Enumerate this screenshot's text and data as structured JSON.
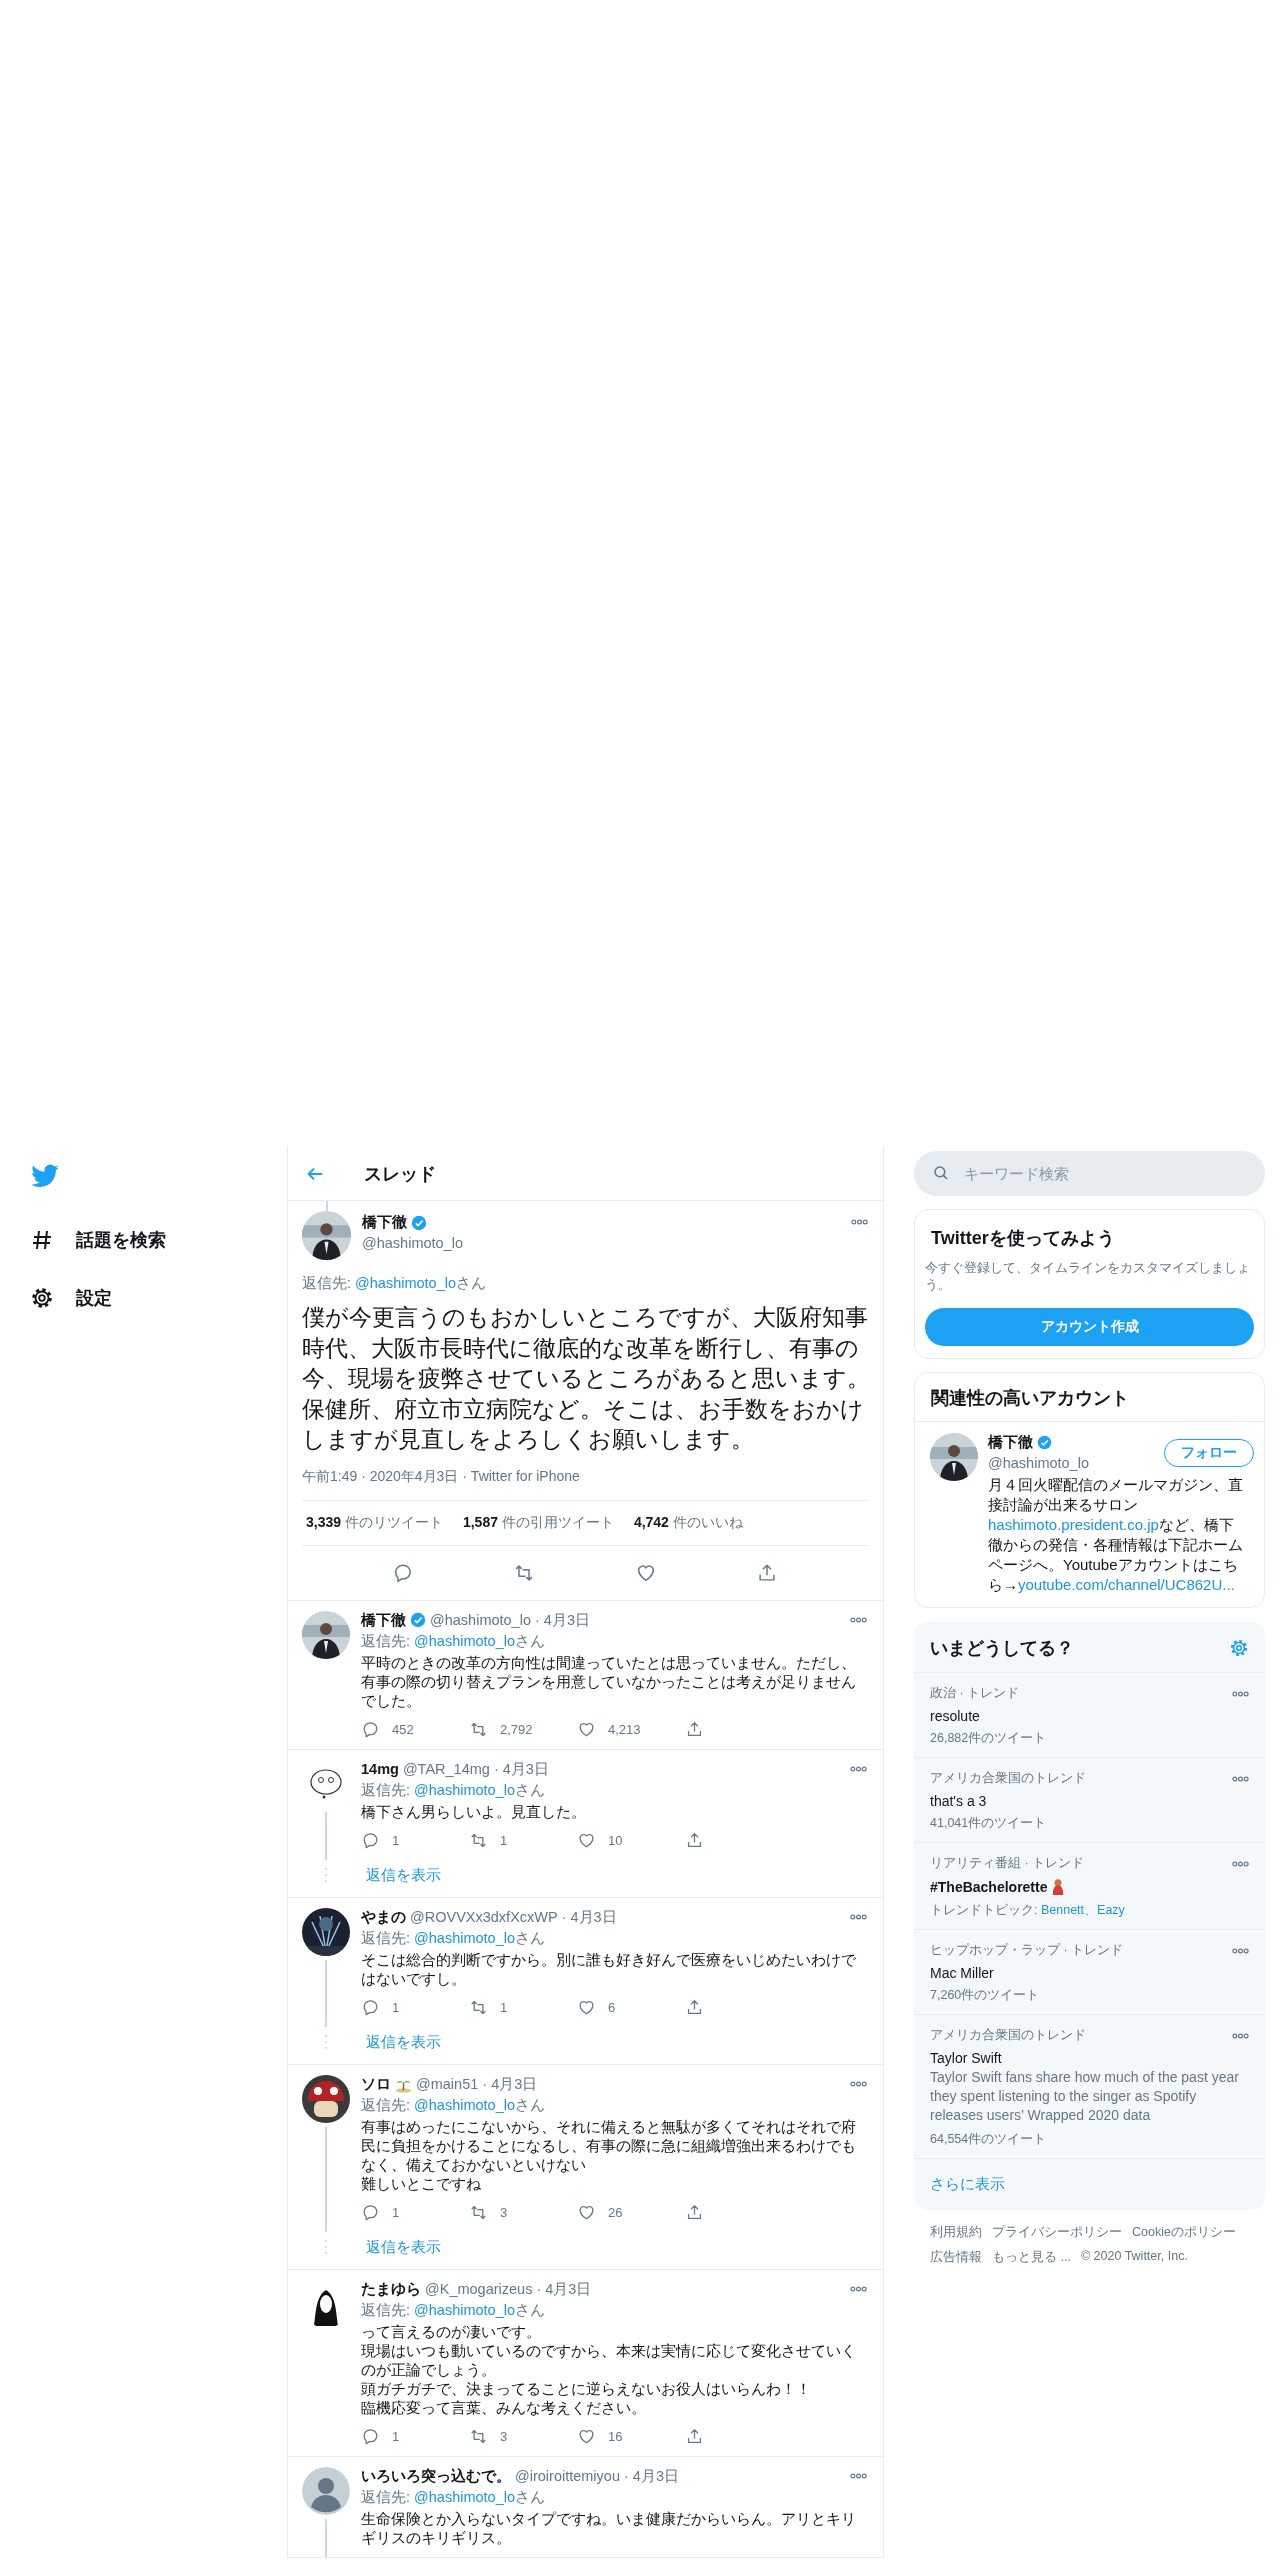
{
  "nav": {
    "items": [
      {
        "label": "話題を検索"
      },
      {
        "label": "設定"
      }
    ]
  },
  "header": {
    "title": "スレッド"
  },
  "main_tweet": {
    "thread_above": true,
    "name": "橋下徹",
    "verified": true,
    "handle": "@hashimoto_lo",
    "reply_prefix": "返信先:",
    "reply_to": "@hashimoto_lo",
    "reply_suffix": "さん",
    "text": [
      "僕が今更言うのもおかしいところですが、大阪府知事時代、大阪市長時代に徹底的な改革を断行し、有事の今、現場を疲弊させているところがあると思います。保健所、府立市立病院など。そこは、お手数をおかけしますが見直しをよろしくお願いします。"
    ],
    "meta": "午前1:49 · 2020年4月3日 · Twitter for iPhone",
    "stats": [
      {
        "count": "3,339",
        "label": "件のリツイート"
      },
      {
        "count": "1,587",
        "label": "件の引用ツイート"
      },
      {
        "count": "4,742",
        "label": "件のいいね"
      }
    ],
    "actions": [
      {
        "kind": "reply"
      },
      {
        "kind": "retweet"
      },
      {
        "kind": "like"
      },
      {
        "kind": "share"
      }
    ]
  },
  "replies": [
    {
      "name": "橋下徹",
      "verified": true,
      "handle": "@hashimoto_lo",
      "date": "· 4月3日",
      "reply_prefix": "返信先:",
      "reply_to": "@hashimoto_lo",
      "reply_suffix": "さん",
      "text": [
        "平時のときの改革の方向性は間違っていたとは思っていません。ただし、有事の際の切り替えプランを用意していなかったことは考えが足りませんでした。"
      ],
      "thread": false,
      "actions": [
        {
          "kind": "reply",
          "count": "452"
        },
        {
          "kind": "retweet",
          "count": "2,792"
        },
        {
          "kind": "like",
          "count": "4,213"
        },
        {
          "kind": "share"
        }
      ]
    },
    {
      "name": "14mg",
      "verified": false,
      "handle": "@TAR_14mg",
      "date": "· 4月3日",
      "reply_prefix": "返信先:",
      "reply_to": "@hashimoto_lo",
      "reply_suffix": "さん",
      "text": [
        "橋下さん男らしいよ。見直した。"
      ],
      "thread": true,
      "actions": [
        {
          "kind": "reply",
          "count": "1"
        },
        {
          "kind": "retweet",
          "count": "1"
        },
        {
          "kind": "like",
          "count": "10"
        },
        {
          "kind": "share"
        }
      ],
      "show_replies": "返信を表示"
    },
    {
      "name": "やまの",
      "verified": false,
      "handle": "@ROVVXx3dxfXcxWP",
      "date": "· 4月3日",
      "reply_prefix": "返信先:",
      "reply_to": "@hashimoto_lo",
      "reply_suffix": "さん",
      "text": [
        "そこは総合的判断ですから。別に誰も好き好んで医療をいじめたいわけではないですし。"
      ],
      "thread": true,
      "actions": [
        {
          "kind": "reply",
          "count": "1"
        },
        {
          "kind": "retweet",
          "count": "1"
        },
        {
          "kind": "like",
          "count": "6"
        },
        {
          "kind": "share"
        }
      ],
      "show_replies": "返信を表示"
    },
    {
      "name": "ソロ",
      "verified": false,
      "handle": "@main51",
      "date": "· 4月3日",
      "reply_prefix": "返信先:",
      "reply_to": "@hashimoto_lo",
      "reply_suffix": "さん",
      "text": [
        "有事はめったにこないから、それに備えると無駄が多くてそれはそれで府民に負担をかけることになるし、有事の際に急に組織増強出来るわけでもなく、備えておかないといけない",
        "難しいとこですね"
      ],
      "thread": true,
      "actions": [
        {
          "kind": "reply",
          "count": "1"
        },
        {
          "kind": "retweet",
          "count": "3"
        },
        {
          "kind": "like",
          "count": "26"
        },
        {
          "kind": "share"
        }
      ],
      "show_replies": "返信を表示"
    },
    {
      "name": "たまゆら",
      "verified": false,
      "handle": "@K_mogarizeus",
      "date": "· 4月3日",
      "reply_prefix": "返信先:",
      "reply_to": "@hashimoto_lo",
      "reply_suffix": "さん",
      "text": [
        "って言えるのが凄いです。",
        "現場はいつも動いているのですから、本来は実情に応じて変化させていくのが正論でしょう。",
        "頭ガチガチで、決まってることに逆らえないお役人はいらんわ！！",
        "臨機応変って言葉、みんな考えください。"
      ],
      "thread": false,
      "actions": [
        {
          "kind": "reply",
          "count": "1"
        },
        {
          "kind": "retweet",
          "count": "3"
        },
        {
          "kind": "like",
          "count": "16"
        },
        {
          "kind": "share"
        }
      ]
    },
    {
      "name": "いろいろ突っ込むで。",
      "verified": false,
      "handle": "@iroiroittemiyou",
      "date": "· 4月3日",
      "reply_prefix": "返信先:",
      "reply_to": "@hashimoto_lo",
      "reply_suffix": "さん",
      "text": [
        "生命保険とか入らないタイプですね。いま健康だからいらん。アリとキリギリスのキリギリス。"
      ],
      "thread": true
    }
  ],
  "sidebar": {
    "search": {
      "placeholder": "キーワード検索"
    },
    "signup": {
      "title": "Twitterを使ってみよう",
      "text": "今すぐ登録して、タイムラインをカスタマイズしましょう。",
      "button": "アカウント作成"
    },
    "related": {
      "title": "関連性の高いアカウント",
      "account": {
        "name": "橋下徹",
        "verified": true,
        "handle": "@hashimoto_lo",
        "button": "フォロー",
        "bio": [
          {
            "text": "月４回火曜配信のメールマガジン、直接討論が出来るサロン",
            "link": false
          },
          {
            "text": "hashimoto.president.co.jp",
            "link": true
          },
          {
            "text": "など、橋下徹からの発信・各種情報は下記ホームページへ。Youtubeアカウントはこちら→",
            "link": false
          },
          {
            "text": "youtube.com/channel/UC862U...",
            "link": true
          }
        ]
      }
    },
    "trends": {
      "title": "いまどうしてる？",
      "items": [
        {
          "context": "政治 · トレンド",
          "name": "resolute",
          "count": "26,882件のツイート"
        },
        {
          "context": "アメリカ合衆国のトレンド",
          "name": "that's a 3",
          "count": "41,041件のツイート"
        },
        {
          "context": "リアリティ番組 · トレンド",
          "name": "#TheBachelorette",
          "topics_label": "トレンドトピック:",
          "topics": "Bennett、Eazy"
        },
        {
          "context": "ヒップホップ・ラップ · トレンド",
          "name": "Mac Miller",
          "count": "7,260件のツイート"
        },
        {
          "context": "アメリカ合衆国のトレンド",
          "name": "Taylor Swift",
          "description": "Taylor Swift fans share how much of the past year they spent listening to the singer as Spotify releases users’ Wrapped 2020 data",
          "count": "64,554件のツイート"
        }
      ],
      "show_more": "さらに表示"
    },
    "footer": {
      "links": [
        "利用規約",
        "プライバシーポリシー",
        "Cookieのポリシー",
        "広告情報",
        "もっと見る ..."
      ],
      "copyright": "© 2020 Twitter, Inc."
    }
  }
}
